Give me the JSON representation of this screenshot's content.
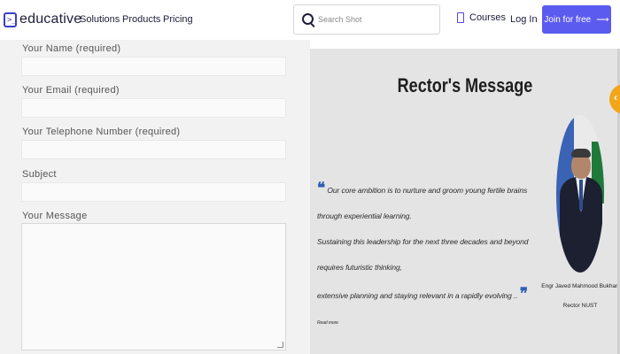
{
  "header": {
    "logo_glyph": ">_",
    "logo_text": "educative",
    "nav": [
      "Solutions",
      "Products",
      "Pricing"
    ],
    "search_placeholder": "Search Shot",
    "courses_label": "Courses",
    "login_label": "Log In",
    "join_label": "Join for free",
    "join_arrow": "⟶"
  },
  "form": {
    "name_label": "Your Name (required)",
    "email_label": "Your Email (required)",
    "phone_label": "Your Telephone Number (required)",
    "subject_label": "Subject",
    "message_label": "Your Message"
  },
  "rector": {
    "title": "Rector's Message",
    "quote_line1": "Our core ambition is to nurture and groom young fertile brains through experiential learning.",
    "quote_line2": "Sustaining this leadership for the next three decades and beyond requires futuristic thinking,",
    "quote_line3": "extensive planning and staying relevant in a rapidly evolving ..",
    "read_more": "Read more",
    "name": "Engr Javed Mahmood Bukhari",
    "role": "Rector NUST",
    "tab_arrow": "‹"
  },
  "colors": {
    "brand": "#5b5bf0",
    "accent_orange": "#f2a619",
    "quote_blue": "#2e5fb4"
  }
}
